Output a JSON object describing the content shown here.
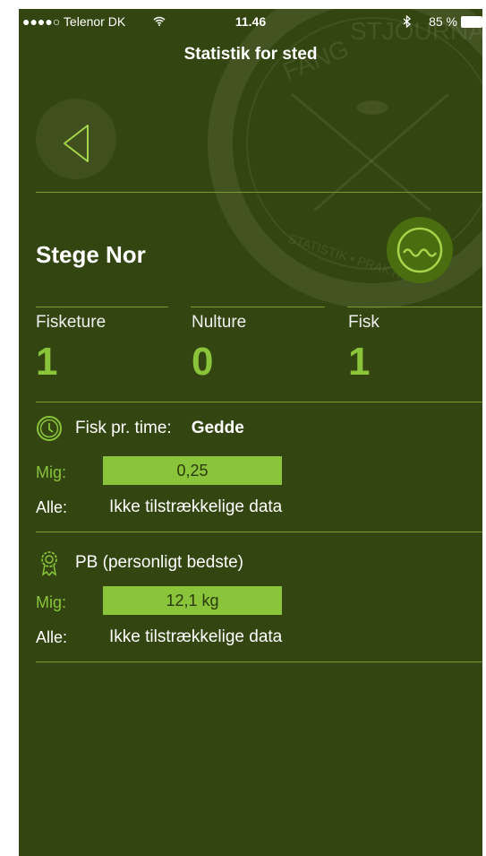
{
  "status_bar": {
    "carrier": "●●●●○ Telenor DK",
    "time": "11.46",
    "bluetooth_battery": "85 %"
  },
  "header": {
    "title": "Statistik for sted"
  },
  "watermark": {
    "brand": "FANGSTJOURNAL",
    "tagline": "STATISTIK • PRAKTISK"
  },
  "place": {
    "name": "Stege Nor"
  },
  "stats": [
    {
      "label": "Fisketure",
      "value": "1"
    },
    {
      "label": "Nulture",
      "value": "0"
    },
    {
      "label": "Fisk",
      "value": "1"
    }
  ],
  "fish_per_hour": {
    "label": "Fisk pr. time:",
    "species": "Gedde",
    "mig_label": "Mig:",
    "mig_value": "0,25",
    "mig_fill": 1.0,
    "alle_label": "Alle:",
    "alle_value": "Ikke tilstrækkelige data"
  },
  "pb": {
    "label": "PB (personligt bedste)",
    "mig_label": "Mig:",
    "mig_value": "12,1 kg",
    "mig_fill": 1.0,
    "alle_label": "Alle:",
    "alle_value": "Ikke tilstrækkelige data"
  },
  "colors": {
    "background": "#334510",
    "accent": "#8ac43a",
    "separator": "#7a9a2c"
  },
  "icons": [
    "back-arrow-icon",
    "wave-icon",
    "clock-icon",
    "award-ribbon-icon",
    "wifi-icon",
    "bluetooth-icon",
    "battery-icon"
  ]
}
